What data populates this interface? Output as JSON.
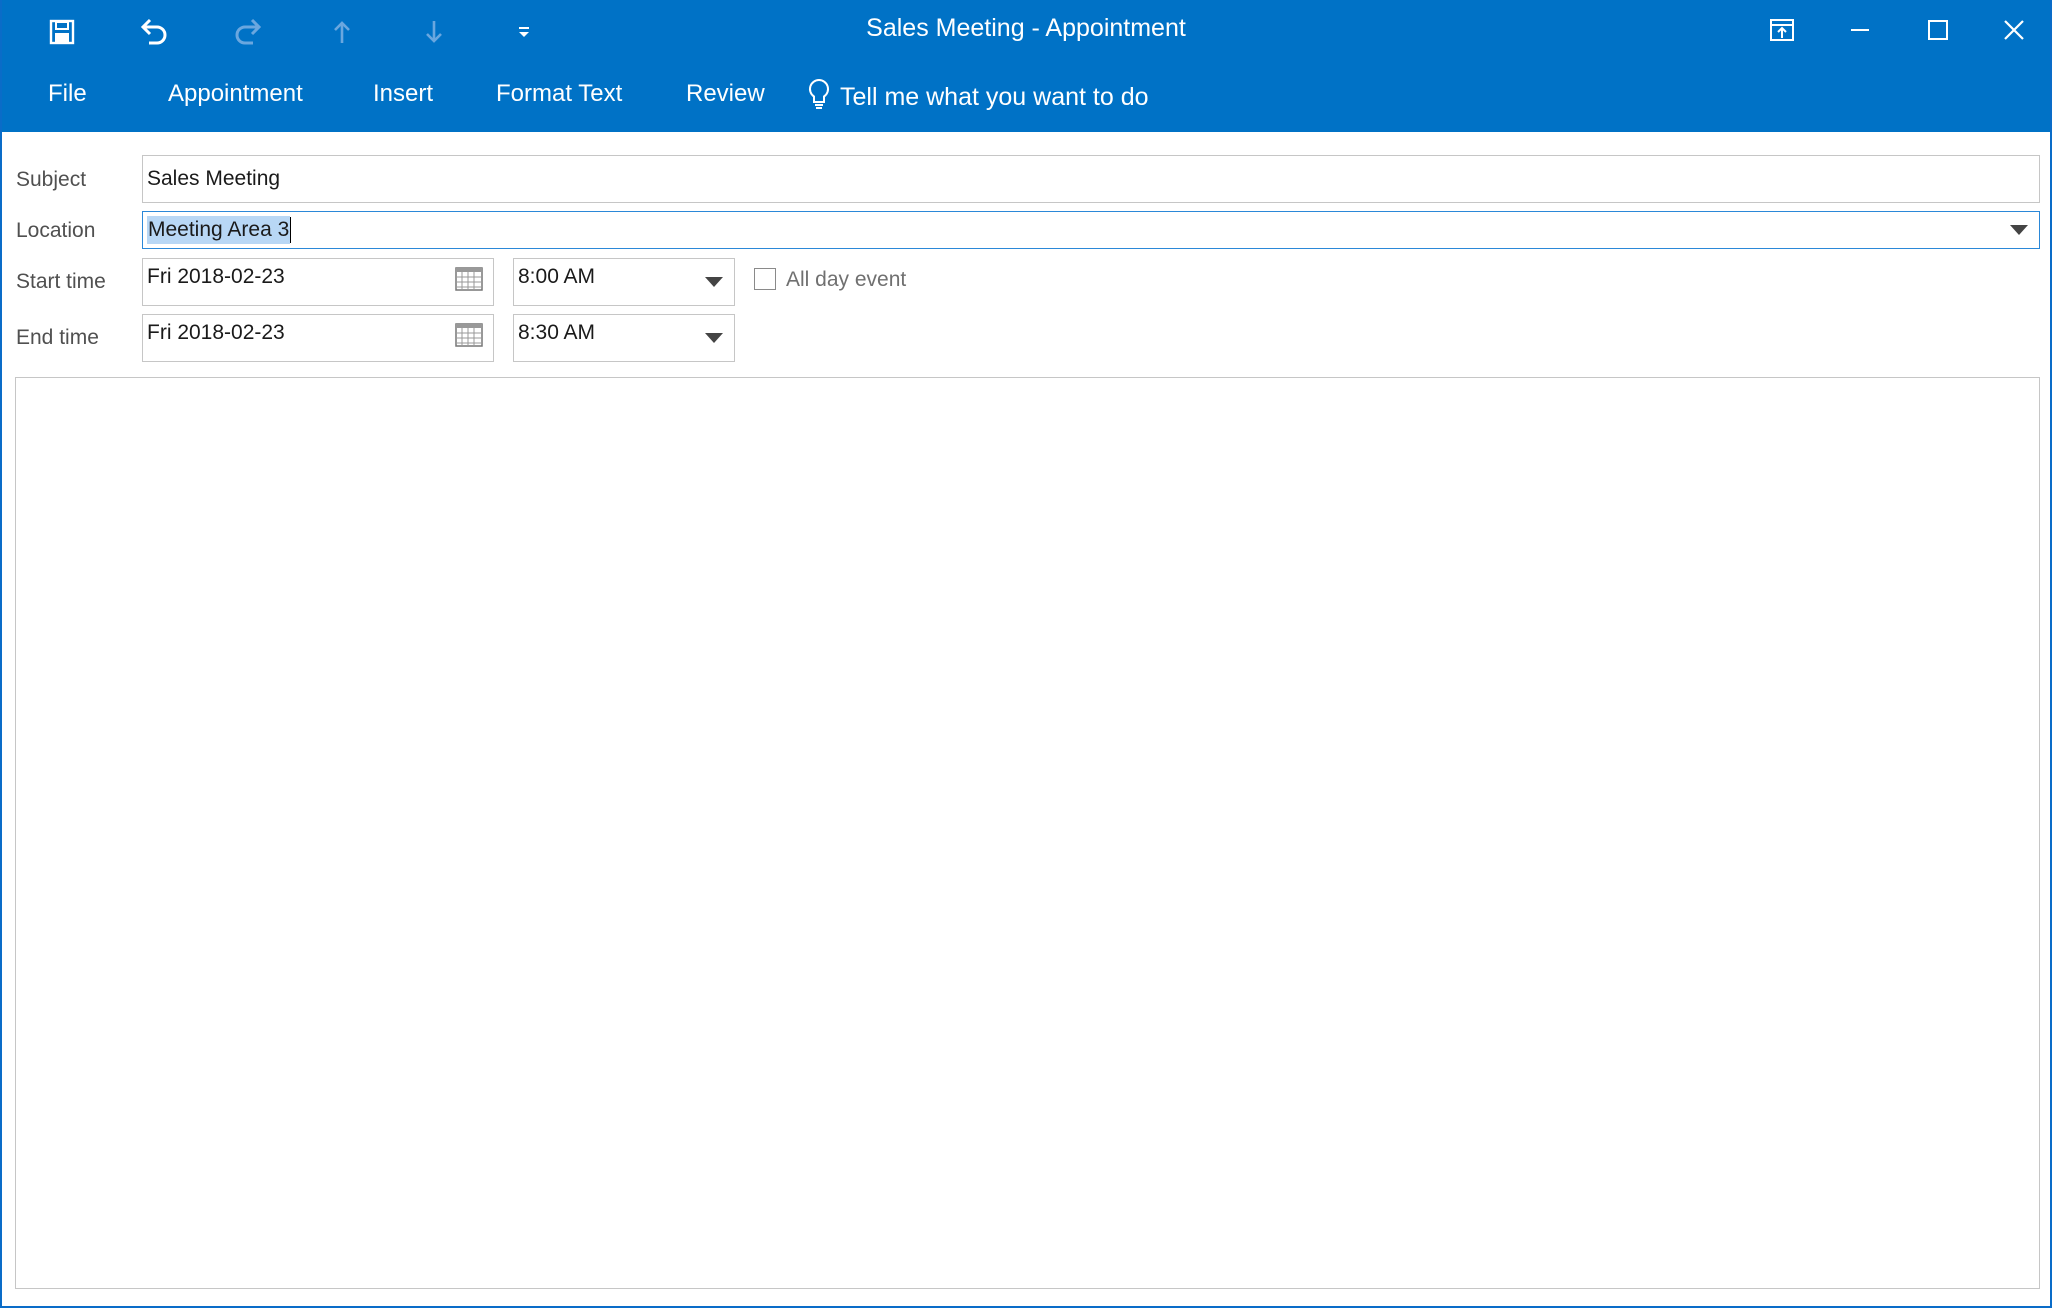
{
  "window": {
    "title": "Sales Meeting  -  Appointment"
  },
  "quick_access": {
    "icons": [
      "save-icon",
      "undo-icon",
      "redo-icon",
      "previous-item-icon",
      "next-item-icon",
      "customize-qat-icon"
    ]
  },
  "window_controls": {
    "icons": [
      "ribbon-display-options-icon",
      "minimize-icon",
      "maximize-icon",
      "close-icon"
    ]
  },
  "ribbon": {
    "tabs": [
      {
        "label": "File"
      },
      {
        "label": "Appointment"
      },
      {
        "label": "Insert"
      },
      {
        "label": "Format Text"
      },
      {
        "label": "Review"
      }
    ],
    "tell_me": "Tell me what you want to do"
  },
  "form": {
    "subject": {
      "label": "Subject",
      "value": "Sales Meeting"
    },
    "location": {
      "label": "Location",
      "value": "Meeting Area 3"
    },
    "start": {
      "label": "Start time",
      "date": "Fri 2018-02-23",
      "time": "8:00 AM"
    },
    "end": {
      "label": "End time",
      "date": "Fri 2018-02-23",
      "time": "8:30 AM"
    },
    "all_day": {
      "label": "All day event",
      "checked": false
    }
  },
  "colors": {
    "accent": "#0072c6",
    "selection": "#b8d7f5",
    "focus_border": "#2b88d8"
  }
}
